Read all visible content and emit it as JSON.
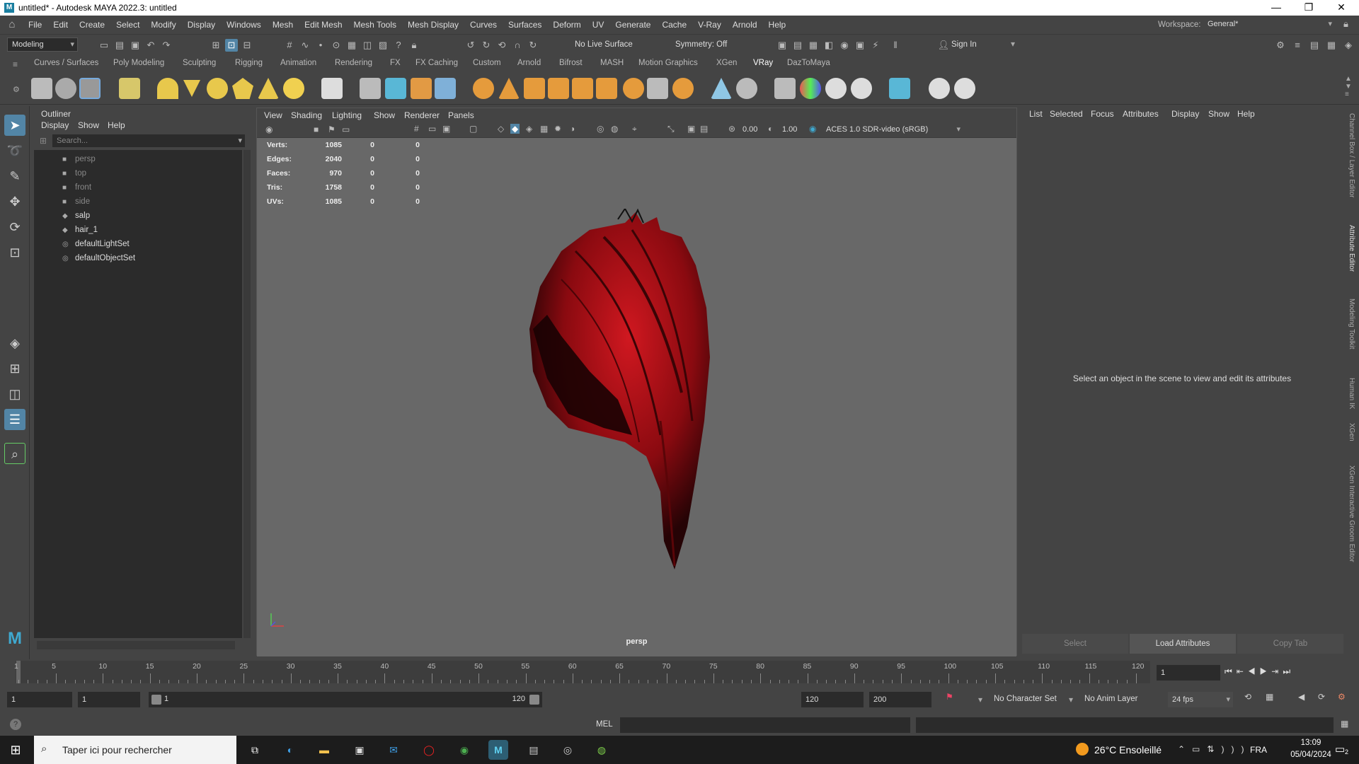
{
  "window": {
    "title": "untitled* - Autodesk MAYA 2022.3: untitled",
    "controls": [
      "—",
      "❐",
      "✕"
    ]
  },
  "menubar": {
    "items": [
      "File",
      "Edit",
      "Create",
      "Select",
      "Modify",
      "Display",
      "Windows",
      "Mesh",
      "Edit Mesh",
      "Mesh Tools",
      "Mesh Display",
      "Curves",
      "Surfaces",
      "Deform",
      "UV",
      "Generate",
      "Cache",
      "V-Ray",
      "Arnold",
      "Help"
    ],
    "workspace_label": "Workspace:",
    "workspace_value": "General*"
  },
  "statusline": {
    "mode": "Modeling",
    "live_surface": "No Live Surface",
    "symmetry": "Symmetry: Off",
    "sign_in": "Sign In"
  },
  "shelf": {
    "tabs": [
      "Curves / Surfaces",
      "Poly Modeling",
      "Sculpting",
      "Rigging",
      "Animation",
      "Rendering",
      "FX",
      "FX Caching",
      "Custom",
      "Arnold",
      "Bifrost",
      "MASH",
      "Motion Graphics",
      "XGen",
      "VRay",
      "DazToMaya"
    ],
    "active_tab": "VRay"
  },
  "outliner": {
    "title": "Outliner",
    "menu": [
      "Display",
      "Show",
      "Help"
    ],
    "search_placeholder": "Search...",
    "items": [
      {
        "label": "persp",
        "dim": true,
        "icon": "camera-icon"
      },
      {
        "label": "top",
        "dim": true,
        "icon": "camera-icon"
      },
      {
        "label": "front",
        "dim": true,
        "icon": "camera-icon"
      },
      {
        "label": "side",
        "dim": true,
        "icon": "camera-icon"
      },
      {
        "label": "salp",
        "dim": false,
        "icon": "mesh-icon"
      },
      {
        "label": "hair_1",
        "dim": false,
        "icon": "mesh-icon"
      },
      {
        "label": "defaultLightSet",
        "dim": false,
        "icon": "set-icon"
      },
      {
        "label": "defaultObjectSet",
        "dim": false,
        "icon": "set-icon"
      }
    ]
  },
  "viewport": {
    "menu": [
      "View",
      "Shading",
      "Lighting",
      "Show",
      "Renderer",
      "Panels"
    ],
    "exposure": "0.00",
    "gamma": "1.00",
    "color_space": "ACES 1.0 SDR-video (sRGB)",
    "camera_label": "persp",
    "hud": [
      {
        "label": "Verts:",
        "v1": "1085",
        "v2": "0",
        "v3": "0"
      },
      {
        "label": "Edges:",
        "v1": "2040",
        "v2": "0",
        "v3": "0"
      },
      {
        "label": "Faces:",
        "v1": "970",
        "v2": "0",
        "v3": "0"
      },
      {
        "label": "Tris:",
        "v1": "1758",
        "v2": "0",
        "v3": "0"
      },
      {
        "label": "UVs:",
        "v1": "1085",
        "v2": "0",
        "v3": "0"
      }
    ]
  },
  "attribute_editor": {
    "menu": [
      "List",
      "Selected",
      "Focus",
      "Attributes",
      "Display",
      "Show",
      "Help"
    ],
    "message": "Select an object in the scene to view and edit its attributes",
    "buttons": [
      "Select",
      "Load Attributes",
      "Copy Tab"
    ]
  },
  "side_tabs": [
    "Channel Box / Layer Editor",
    "Attribute Editor",
    "Modeling Toolkit",
    "Human IK",
    "XGen",
    "XGen Interactive Groom Editor"
  ],
  "timeline": {
    "ticks": [
      "1",
      "5",
      "10",
      "15",
      "20",
      "25",
      "30",
      "35",
      "40",
      "45",
      "50",
      "55",
      "60",
      "65",
      "70",
      "75",
      "80",
      "85",
      "90",
      "95",
      "100",
      "105",
      "110",
      "115",
      "120"
    ],
    "current_frame": "1"
  },
  "range": {
    "start": "1",
    "playback_start": "1",
    "slider_start": "1",
    "slider_end": "120",
    "playback_end": "120",
    "end": "200",
    "character_set": "No Character Set",
    "anim_layer": "No Anim Layer",
    "fps": "24 fps"
  },
  "command_line": {
    "label": "MEL"
  },
  "taskbar": {
    "search_placeholder": "Taper ici pour rechercher",
    "weather": "26°C  Ensoleillé",
    "lang": "FRA",
    "time": "13:09",
    "date": "05/04/2024",
    "notif_count": "2"
  }
}
